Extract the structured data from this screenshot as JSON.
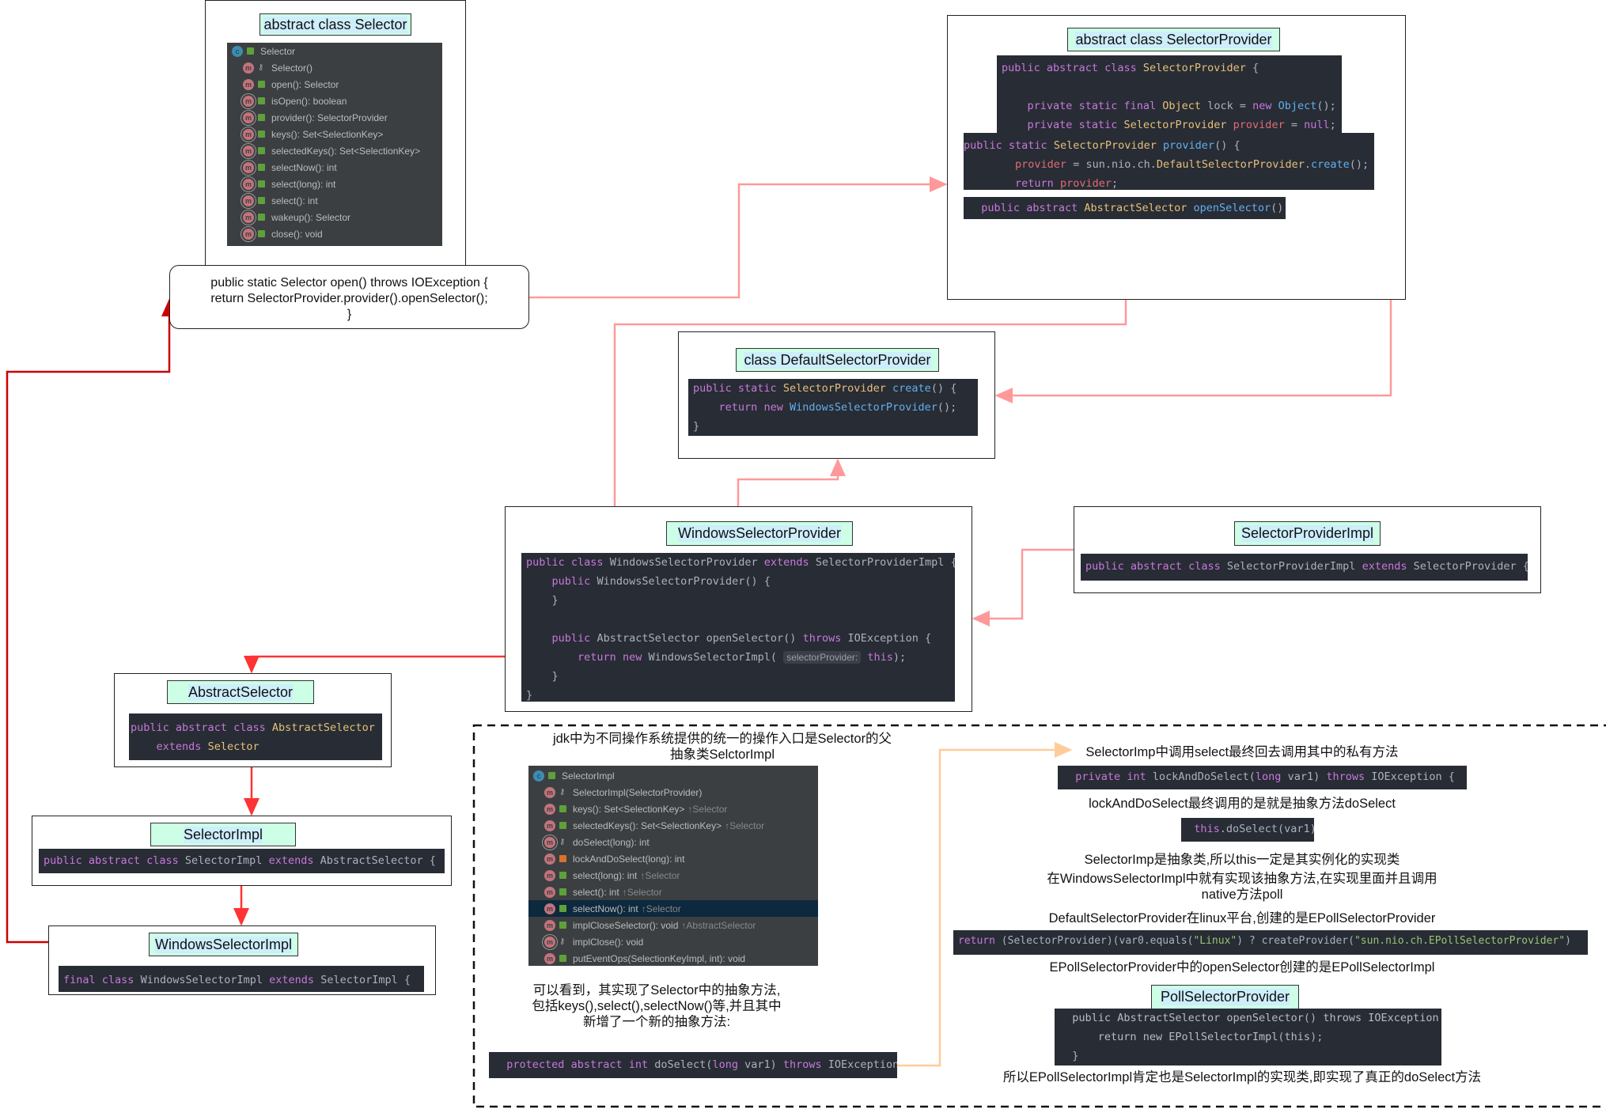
{
  "colors": {
    "arrow_light": "#ff9999",
    "arrow_red": "#ff3333",
    "arrow_dark": "#cc0000",
    "arrow_orange": "#ffcc99",
    "title_fill": "#ccffe6",
    "code_bg": "#282c34"
  },
  "selector": {
    "title": "abstract class Selector",
    "struct": {
      "header": "Selector",
      "items": [
        {
          "icon": "method",
          "access": "key",
          "label": "Selector()"
        },
        {
          "icon": "method",
          "access": "public",
          "label": "open(): Selector"
        },
        {
          "icon": "abstract-method",
          "access": "public",
          "label": "isOpen(): boolean"
        },
        {
          "icon": "abstract-method",
          "access": "public",
          "label": "provider(): SelectorProvider"
        },
        {
          "icon": "abstract-method",
          "access": "public",
          "label": "keys(): Set<SelectionKey>"
        },
        {
          "icon": "abstract-method",
          "access": "public",
          "label": "selectedKeys(): Set<SelectionKey>"
        },
        {
          "icon": "abstract-method",
          "access": "public",
          "label": "selectNow(): int"
        },
        {
          "icon": "abstract-method",
          "access": "public",
          "label": "select(long): int"
        },
        {
          "icon": "abstract-method",
          "access": "public",
          "label": "select(): int"
        },
        {
          "icon": "abstract-method",
          "access": "public",
          "label": "wakeup(): Selector"
        },
        {
          "icon": "abstract-method",
          "access": "public",
          "label": "close(): void"
        }
      ]
    },
    "open_code": [
      "public static Selector open() throws IOException {",
      "return SelectorProvider.provider().openSelector();",
      "}"
    ]
  },
  "selector_provider": {
    "title": "abstract class SelectorProvider",
    "code1": [
      "public abstract class SelectorProvider {",
      "",
      "    private static final Object lock = new Object();",
      "    private static SelectorProvider provider = null;"
    ],
    "code2": [
      "public static SelectorProvider provider() {",
      "        provider = sun.nio.ch.DefaultSelectorProvider.create();",
      "        return provider;"
    ],
    "code3": [
      "  public abstract AbstractSelector openSelector()"
    ]
  },
  "default_selector_provider": {
    "title": "class DefaultSelectorProvider",
    "code": [
      "public static SelectorProvider create() {",
      "    return new WindowsSelectorProvider();",
      "}"
    ]
  },
  "windows_selector_provider": {
    "title": "WindowsSelectorProvider",
    "code": [
      "public class WindowsSelectorProvider extends SelectorProviderImpl {",
      "    public WindowsSelectorProvider() {",
      "    }",
      "",
      "    public AbstractSelector openSelector() throws IOException {",
      "        return new WindowsSelectorImpl( selectorProvider: this);",
      "    }",
      "}"
    ]
  },
  "selector_provider_impl": {
    "title": "SelectorProviderImpl",
    "code": [
      "public abstract class SelectorProviderImpl extends SelectorProvider {"
    ]
  },
  "abstract_selector": {
    "title": "AbstractSelector",
    "code": [
      "public abstract class AbstractSelector",
      "    extends Selector"
    ]
  },
  "selector_impl": {
    "title": "SelectorImpl",
    "code": [
      "public abstract class SelectorImpl extends AbstractSelector {"
    ]
  },
  "windows_selector_impl": {
    "title": "WindowsSelectorImpl",
    "code": [
      "final class WindowsSelectorImpl extends SelectorImpl {"
    ]
  },
  "notes": {
    "jdk_entry": [
      "jdk中为不同操作系统提供的统一的操作入口是Selector的父",
      "抽象类SelctorImpl"
    ],
    "selector_impl_struct": {
      "header": "SelectorImpl",
      "items": [
        {
          "icon": "method",
          "access": "key",
          "label": "SelectorImpl(SelectorProvider)",
          "from": ""
        },
        {
          "icon": "method",
          "access": "public",
          "label": "keys(): Set<SelectionKey>",
          "from": "↑Selector"
        },
        {
          "icon": "method",
          "access": "public",
          "label": "selectedKeys(): Set<SelectionKey>",
          "from": "↑Selector"
        },
        {
          "icon": "abstract-method",
          "access": "key",
          "label": "doSelect(long): int",
          "from": ""
        },
        {
          "icon": "method",
          "access": "private",
          "label": "lockAndDoSelect(long): int",
          "from": ""
        },
        {
          "icon": "method",
          "access": "public",
          "label": "select(long): int",
          "from": "↑Selector"
        },
        {
          "icon": "method",
          "access": "public",
          "label": "select(): int",
          "from": "↑Selector"
        },
        {
          "icon": "method",
          "access": "public",
          "label": "selectNow(): int",
          "from": "↑Selector",
          "selected": true
        },
        {
          "icon": "method",
          "access": "public",
          "label": "implCloseSelector(): void",
          "from": "↑AbstractSelector"
        },
        {
          "icon": "abstract-method",
          "access": "key",
          "label": "implClose(): void",
          "from": ""
        },
        {
          "icon": "method",
          "access": "public",
          "label": "putEventOps(SelectionKeyImpl, int): void",
          "from": ""
        }
      ]
    },
    "implemented": [
      "可以看到，其实现了Selector中的抽象方法,",
      "包括keys(),select(),selectNow()等,并且其中",
      "新增了一个新的抽象方法:"
    ],
    "do_select_code": [
      "  protected abstract int doSelect(long var1) throws IOException;"
    ],
    "select_calls": "SelectorImp中调用select最终回去调用其中的私有方法",
    "lock_code": [
      "  private int lockAndDoSelect(long var1) throws IOException {"
    ],
    "lock_calls": "lockAndDoSelect最终调用的是就是抽象方法doSelect",
    "this_code": [
      "  this.doSelect(var1);"
    ],
    "abstract_class": "SelectorImp是抽象类,所以this一定是其实例化的实现类",
    "windows_impl": [
      "在WindowsSelectorImpl中就有实现该抽象方法,在实现里面并且调用",
      "native方法poll"
    ],
    "linux": "DefaultSelectorProvider在linux平台,创建的是EPollSelectorProvider",
    "return_code": [
      "return (SelectorProvider)(var0.equals(\"Linux\") ? createProvider(\"sun.nio.ch.EPollSelectorProvider\")"
    ],
    "epoll_open": "EPollSelectorProvider中的openSelector创建的是EPollSelectorImpl",
    "poll_title": "PollSelectorProvider",
    "poll_code": [
      "  public AbstractSelector openSelector() throws IOException {",
      "      return new EPollSelectorImpl(this);",
      "  }"
    ],
    "conclusion": "所以EPollSelectorImpl肯定也是SelectorImpl的实现类,即实现了真正的doSelect方法"
  }
}
